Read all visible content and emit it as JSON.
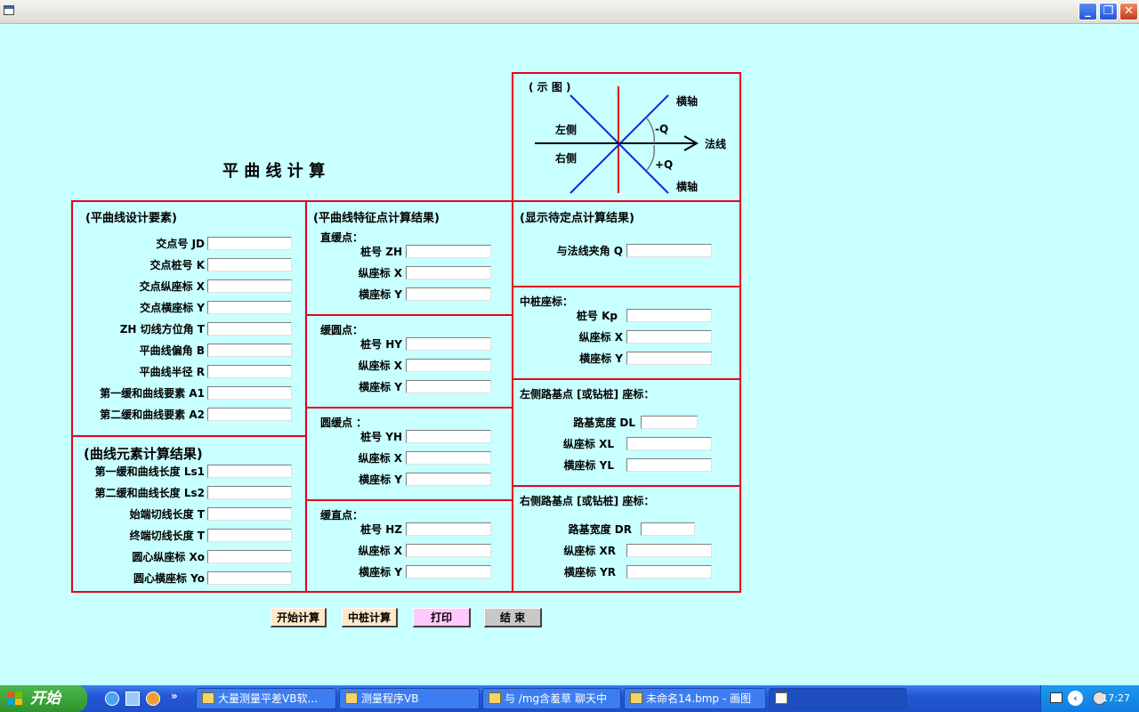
{
  "page_title": "平 曲 线 计 算",
  "diagram": {
    "title": "( 示  图 )",
    "left": "左侧",
    "right": "右侧",
    "axis_top": "横轴",
    "axis_bottom": "横轴",
    "normal": "法线",
    "minus_q": "-Q",
    "plus_q": "+Q"
  },
  "design": {
    "header": "(平曲线设计要素)",
    "fields": [
      "交点号 JD",
      "交点桩号 K",
      "交点纵座标 X",
      "交点横座标 Y",
      "ZH 切线方位角 T",
      "平曲线偏角 B",
      "平曲线半径 R",
      "第一缓和曲线要素 A1",
      "第二缓和曲线要素 A2"
    ]
  },
  "elements": {
    "header": "(曲线元素计算结果)",
    "fields": [
      "第一缓和曲线长度 Ls1",
      "第二缓和曲线长度 Ls2",
      "始端切线长度 T",
      "终端切线长度 T",
      "圆心纵座标 Xo",
      "圆心横座标 Yo"
    ]
  },
  "feature": {
    "header": "(平曲线特征点计算结果)",
    "groups": [
      {
        "title": "直缓点：",
        "fields": [
          "桩号 ZH",
          "纵座标 X",
          "横座标 Y"
        ]
      },
      {
        "title": "缓圆点：",
        "fields": [
          "桩号 HY",
          "纵座标 X",
          "横座标 Y"
        ]
      },
      {
        "title": "圆缓点 ：",
        "fields": [
          "桩号 YH",
          "纵座标 X",
          "横座标 Y"
        ]
      },
      {
        "title": "缓直点：",
        "fields": [
          "桩号 HZ",
          "纵座标 X",
          "横座标 Y"
        ]
      }
    ]
  },
  "pending": {
    "header": "(显示待定点计算结果)",
    "angle": "与法线夹角  Q",
    "center_title": "中桩座标：",
    "center_fields": [
      "桩号 Kp",
      "纵座标 X",
      "横座标 Y"
    ],
    "left_title": "左侧路基点 [或钻桩] 座标：",
    "left_fields": [
      "路基宽度 DL",
      "纵座标 XL",
      "横座标 YL"
    ],
    "right_title": "右侧路基点 [或钻桩] 座标：",
    "right_fields": [
      "路基宽度 DR",
      "纵座标 XR",
      "横座标 YR"
    ]
  },
  "buttons": {
    "start": "开始计算",
    "center": "中桩计算",
    "print": "打印",
    "end": "结 束"
  },
  "colors": {
    "background": "#c8ffff",
    "frame": "#e8001c",
    "diagram_lines": "#1428d4"
  },
  "taskbar": {
    "start": "开始",
    "items": [
      "大量测量平差VB软...",
      "测量程序VB",
      "与 /mg含羞草 聊天中",
      "未命名14.bmp - 画图",
      ""
    ],
    "clock": "17:27"
  }
}
